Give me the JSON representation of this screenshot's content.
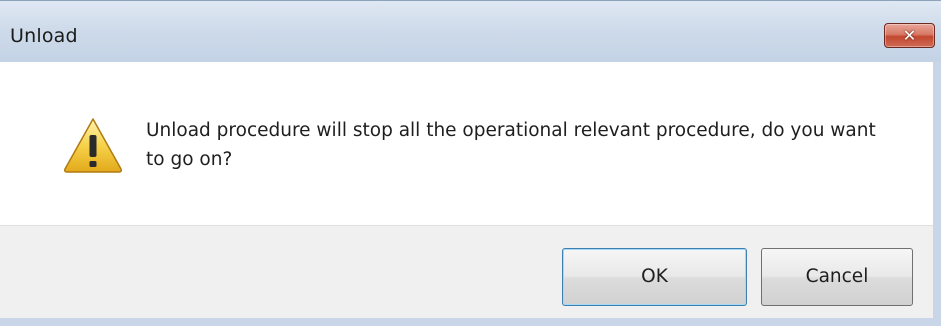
{
  "window": {
    "title": "Unload"
  },
  "close_button": {
    "glyph": "✕",
    "icon": "close-icon",
    "color": "#c74b35"
  },
  "message": {
    "icon": "warning-icon",
    "text": "Unload procedure will stop all the operational relevant procedure, do you want to go on?"
  },
  "buttons": {
    "ok_label": "OK",
    "cancel_label": "Cancel"
  },
  "colors": {
    "titlebar": "#cfdbea",
    "footer": "#f0f0f0",
    "warning_fill": "#f6d24a"
  }
}
